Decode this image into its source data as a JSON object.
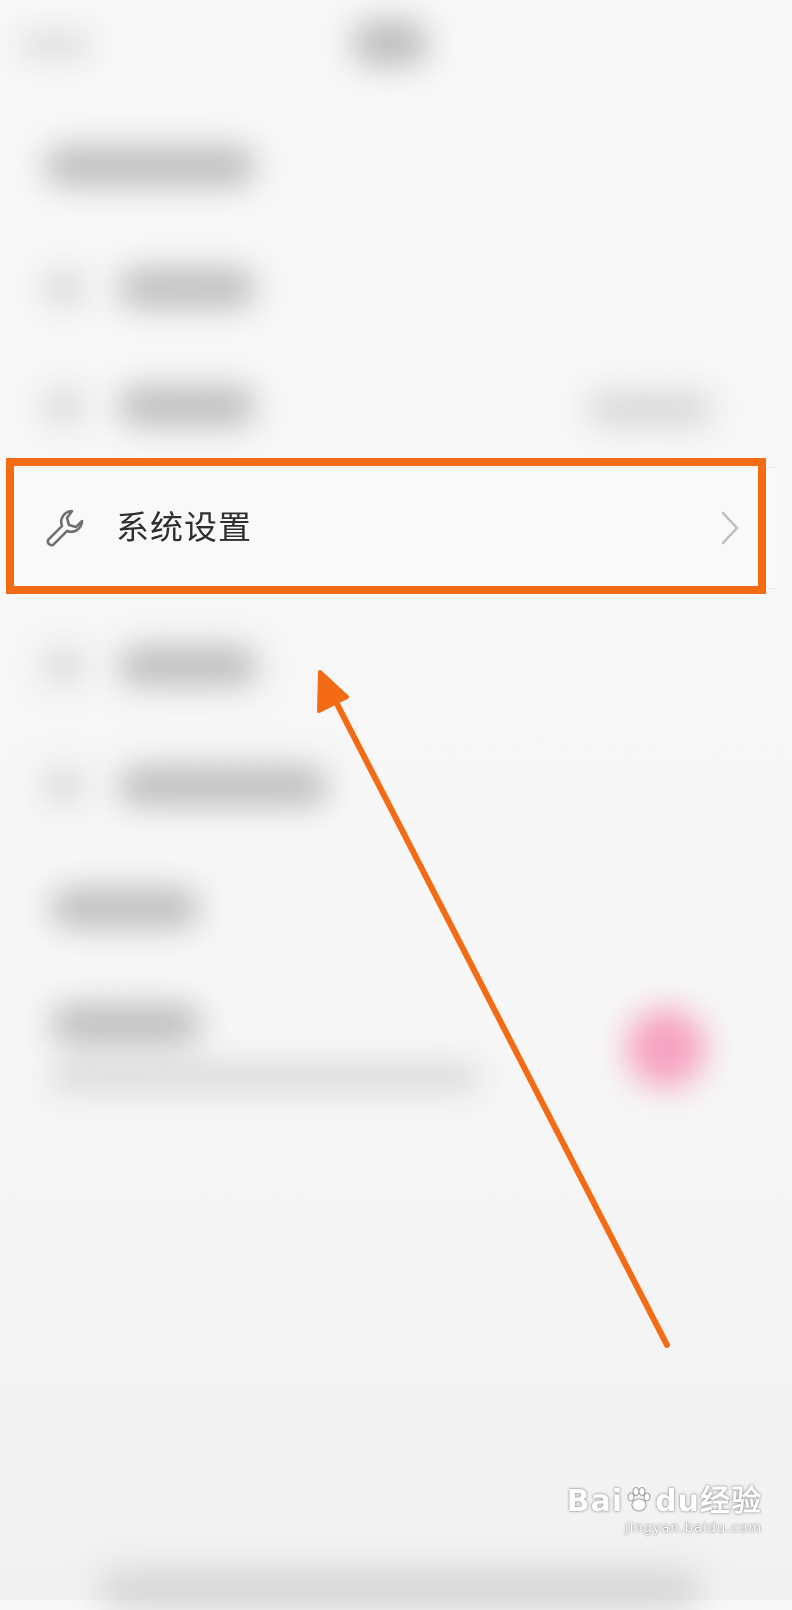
{
  "menu": {
    "settings_item": {
      "label": "系统设置",
      "icon": "wrench-icon",
      "trailing_icon": "chevron-right-icon"
    }
  },
  "annotation": {
    "highlight_color": "#f36c15",
    "arrow_color": "#f36c15"
  },
  "watermark": {
    "brand_left": "Bai",
    "brand_right": "du",
    "brand_cn": "经验",
    "url": "jingyan.baidu.com"
  }
}
